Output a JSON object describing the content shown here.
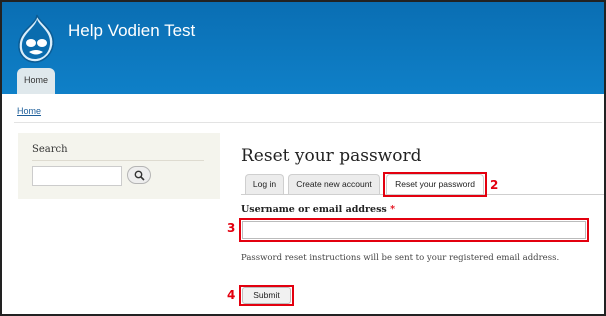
{
  "header": {
    "site_name": "Help Vodien Test",
    "nav_tab": "Home",
    "colors": {
      "banner": "#0f7cc2",
      "tab": "#dfe8ec"
    }
  },
  "breadcrumb": "Home",
  "sidebar": {
    "search_title": "Search",
    "search_placeholder": "",
    "search_button_icon": "magnifier-icon"
  },
  "main": {
    "title": "Reset your password",
    "tabs": [
      {
        "label": "Log in",
        "active": false
      },
      {
        "label": "Create new account",
        "active": false
      },
      {
        "label": "Reset your password",
        "active": true
      }
    ],
    "field_label": "Username or email address",
    "required_mark": "*",
    "field_value": "",
    "help_text": "Password reset instructions will be sent to your registered email address.",
    "submit_label": "Submit"
  },
  "annotations": {
    "color": "#e3000f",
    "numbers": [
      "2",
      "3",
      "4"
    ]
  }
}
